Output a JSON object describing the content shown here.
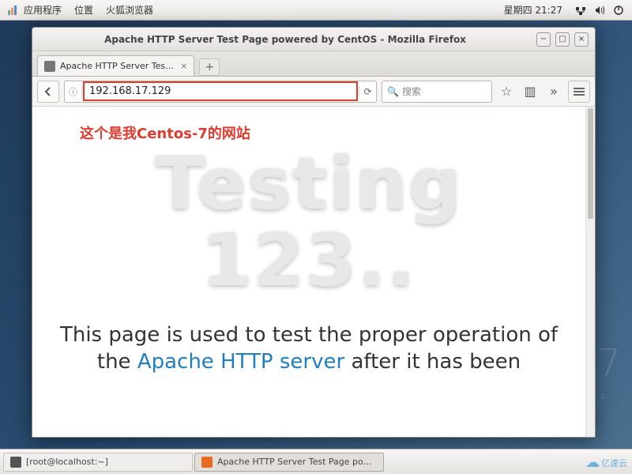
{
  "topbar": {
    "menus": [
      "应用程序",
      "位置",
      "火狐浏览器"
    ],
    "clock": "星期四 21:27"
  },
  "window": {
    "title": "Apache HTTP Server Test Page powered by CentOS - Mozilla Firefox",
    "tab_label": "Apache HTTP Server Tes…",
    "url": "192.168.17.129",
    "search_placeholder": "搜索"
  },
  "page": {
    "annotation": "这个是我Centos-7的网站",
    "hero_line1": "Testing",
    "hero_line2": "123..",
    "para_pre": "This page is used to test the proper operation of the ",
    "para_link": "Apache HTTP server",
    "para_post": " after it has been"
  },
  "taskbar": {
    "term": "[root@localhost:~]",
    "ff": "Apache HTTP Server Test Page po…"
  },
  "watermark": {
    "big": "7",
    "sub": "os"
  },
  "logo": "亿速云"
}
